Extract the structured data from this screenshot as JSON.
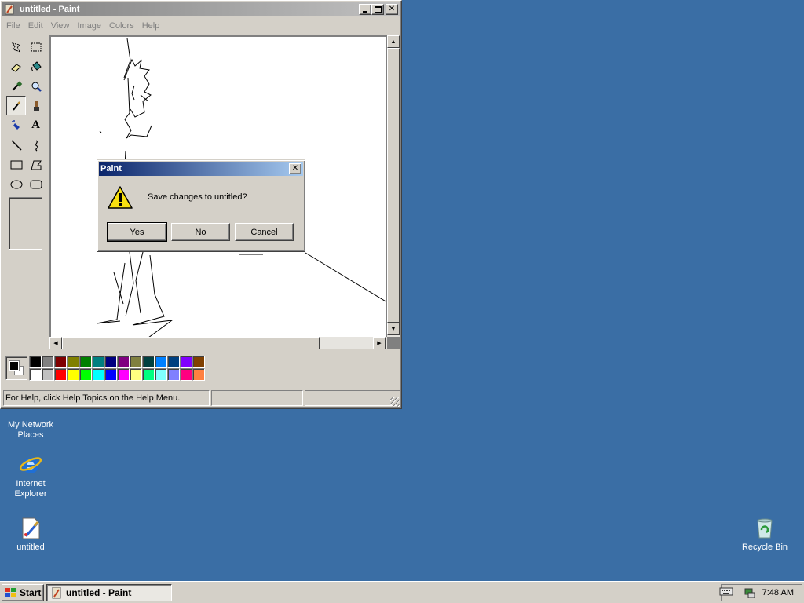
{
  "desktop": {
    "icons": [
      {
        "label": "My Network Places",
        "icon": "network-places-icon"
      },
      {
        "label": "Internet Explorer",
        "icon": "internet-explorer-icon"
      },
      {
        "label": "untitled",
        "icon": "paint-file-icon"
      },
      {
        "label": "Recycle Bin",
        "icon": "recycle-bin-icon"
      }
    ],
    "background": "#3a6ea5"
  },
  "paint": {
    "title": "untitled - Paint",
    "menu": [
      "File",
      "Edit",
      "View",
      "Image",
      "Colors",
      "Help"
    ],
    "tools": [
      "free-form-select-tool",
      "select-tool",
      "eraser-tool",
      "fill-tool",
      "pick-color-tool",
      "magnifier-tool",
      "pencil-tool",
      "brush-tool",
      "airbrush-tool",
      "text-tool",
      "line-tool",
      "curve-tool",
      "rectangle-tool",
      "polygon-tool",
      "ellipse-tool",
      "rounded-rectangle-tool"
    ],
    "selected_tool": "pencil-tool",
    "text_tool_glyph": "A",
    "palette_top": [
      "#000000",
      "#808080",
      "#800000",
      "#808000",
      "#008000",
      "#008080",
      "#000080",
      "#800080",
      "#808040",
      "#004040",
      "#0080ff",
      "#004080",
      "#8000ff",
      "#804000"
    ],
    "palette_bottom": [
      "#ffffff",
      "#c0c0c0",
      "#ff0000",
      "#ffff00",
      "#00ff00",
      "#00ffff",
      "#0000ff",
      "#ff00ff",
      "#ffff80",
      "#00ff80",
      "#80ffff",
      "#8080ff",
      "#ff0080",
      "#ff8040"
    ],
    "foreground_color": "#000000",
    "background_color": "#ffffff",
    "status_text": "For Help, click Help Topics on the Help Menu."
  },
  "dialog": {
    "title": "Paint",
    "message": "Save changes to untitled?",
    "icon": "warning-icon",
    "buttons": {
      "yes": "Yes",
      "no": "No",
      "cancel": "Cancel"
    }
  },
  "taskbar": {
    "start_label": "Start",
    "task_label": "untitled - Paint",
    "clock": "7:48 AM"
  }
}
